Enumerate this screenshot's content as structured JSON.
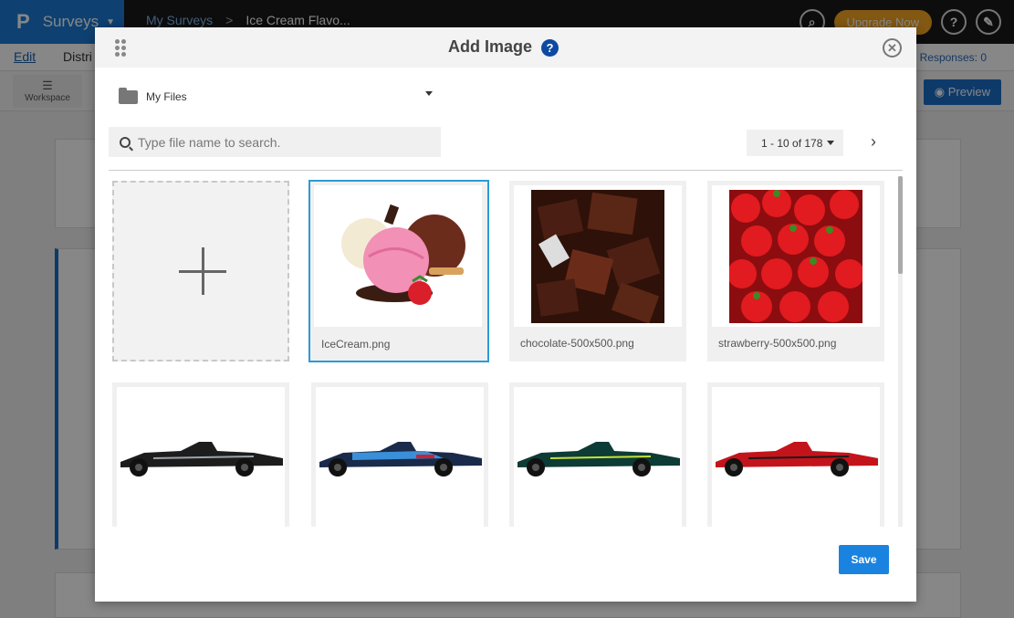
{
  "app": {
    "name": "Surveys",
    "logo": "P",
    "breadcrumb": [
      "My Surveys",
      "Ice Cream Flavo..."
    ],
    "upgrade_label": "Upgrade Now",
    "menu": {
      "edit": "Edit",
      "distribute": "Distri"
    },
    "responses": "Responses: 0",
    "workspace_label": "Workspace",
    "preview_label": "Preview"
  },
  "modal": {
    "title": "Add Image",
    "folder": "My Files",
    "search_placeholder": "Type file name to search.",
    "pager": "1 - 10 of 178",
    "save_label": "Save",
    "images": [
      {
        "name": "IceCream.png",
        "icon": "ice-cream-image",
        "selected": true
      },
      {
        "name": "chocolate-500x500.png",
        "icon": "chocolate-image"
      },
      {
        "name": "strawberry-500x500.png",
        "icon": "strawberry-image"
      },
      {
        "name": "",
        "icon": "f1-car-black-image"
      },
      {
        "name": "",
        "icon": "f1-car-blue-image"
      },
      {
        "name": "",
        "icon": "f1-car-green-image"
      },
      {
        "name": "",
        "icon": "f1-car-red-image"
      }
    ]
  },
  "colors": {
    "brand": "#1b7bd6",
    "accent": "#1a83e0",
    "upgrade": "#f5a623",
    "selected_border": "#2a9bd6"
  }
}
